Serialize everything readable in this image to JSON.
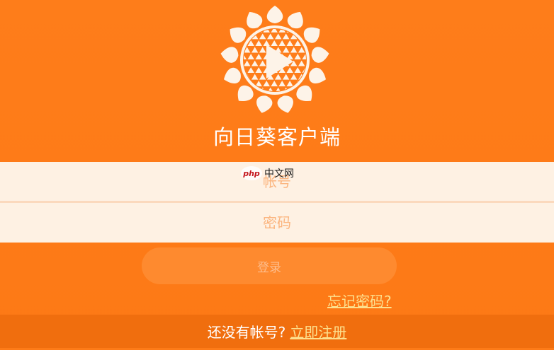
{
  "app": {
    "title": "向日葵客户端"
  },
  "login_form": {
    "username_placeholder": "帐号",
    "password_placeholder": "密码",
    "login_label": "登录",
    "forgot_label": "忘记密码?"
  },
  "footer": {
    "prompt": "还没有帐号?",
    "register_label": "立即注册"
  },
  "watermark": {
    "brand": "php",
    "text": "中文网"
  },
  "colors": {
    "background": "#fd7b18",
    "field_background": "#fef1e3",
    "link": "#fde08e",
    "footer": "#f06e0e",
    "button": "#fe8a2f"
  },
  "icons": {
    "logo": "sunflower-play-icon"
  }
}
